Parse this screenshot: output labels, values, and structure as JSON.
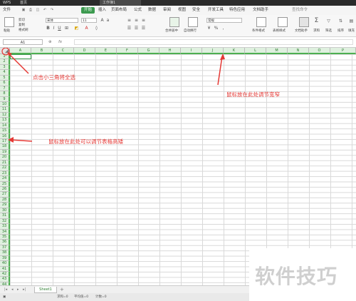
{
  "titlebar": {
    "tabs": [
      {
        "label": "WPS"
      },
      {
        "label": "首页"
      },
      {
        "label": "工作簿1"
      }
    ]
  },
  "menubar": {
    "file": "文件",
    "items": [
      "开始",
      "插入",
      "页面布局",
      "公式",
      "数据",
      "审阅",
      "视图",
      "安全",
      "开发工具",
      "特色应用",
      "文档助手"
    ],
    "search": "查找命令"
  },
  "ribbon": {
    "paste": "粘贴",
    "cut": "剪切",
    "copy": "复制",
    "format_painter": "格式刷",
    "font": "宋体",
    "font_size": "11",
    "merge": "合并居中",
    "wrap": "自动换行",
    "number_format": "常规",
    "cond_format": "条件格式",
    "table_style": "表格样式",
    "doc_helper": "文档助手",
    "sum": "求和",
    "filter": "筛选",
    "sort": "排序",
    "fill": "填充"
  },
  "formula": {
    "name_box": "A1",
    "fx": "fx"
  },
  "columns": [
    "A",
    "B",
    "C",
    "D",
    "E",
    "F",
    "G",
    "H",
    "I",
    "J",
    "K",
    "L",
    "M",
    "N",
    "O",
    "P"
  ],
  "rows": [
    "1",
    "2",
    "3",
    "4",
    "5",
    "6",
    "7",
    "8",
    "9",
    "10",
    "11",
    "12",
    "13",
    "14",
    "15",
    "16",
    "17",
    "18",
    "19",
    "20",
    "21",
    "22",
    "23",
    "24",
    "25",
    "26",
    "27",
    "28",
    "29",
    "30",
    "31",
    "32",
    "33",
    "34",
    "35",
    "36",
    "37",
    "38",
    "39",
    "40",
    "41",
    "42",
    "43",
    "44"
  ],
  "annotations": {
    "corner_note": "点击小三角将全选",
    "column_note": "鼠标放在此处调节宽窄",
    "row_note": "鼠标放在此处可以调节表格高矮"
  },
  "tabs": {
    "sheet": "Sheet1",
    "add": "+"
  },
  "status": {
    "sum": "求和=0",
    "avg": "平均值=0",
    "count": "计数=0"
  },
  "watermark": "软件技巧",
  "colors": {
    "accent": "#3c9a4f",
    "annotation": "#e53935"
  }
}
